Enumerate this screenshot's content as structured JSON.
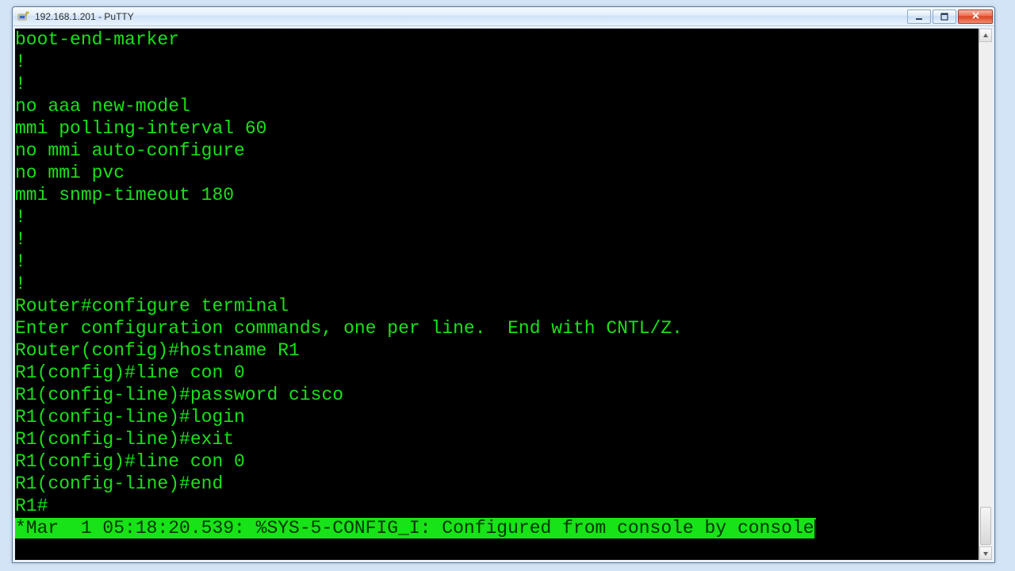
{
  "window": {
    "title": "192.168.1.201 - PuTTY"
  },
  "colors": {
    "term_fg": "#18e218",
    "term_bg": "#000000",
    "hl_bg": "#18e218",
    "hl_fg": "#003500"
  },
  "terminal": {
    "lines": [
      "boot-end-marker",
      "!",
      "!",
      "no aaa new-model",
      "mmi polling-interval 60",
      "no mmi auto-configure",
      "no mmi pvc",
      "mmi snmp-timeout 180",
      "!",
      "!",
      "!",
      "!",
      "",
      "Router#configure terminal",
      "Enter configuration commands, one per line.  End with CNTL/Z.",
      "Router(config)#hostname R1",
      "R1(config)#line con 0",
      "R1(config-line)#password cisco",
      "R1(config-line)#login",
      "R1(config-line)#exit",
      "R1(config)#line con 0",
      "R1(config-line)#end",
      "R1#"
    ],
    "highlight_line": "*Mar  1 05:18:20.539: %SYS-5-CONFIG_I: Configured from console by console"
  }
}
